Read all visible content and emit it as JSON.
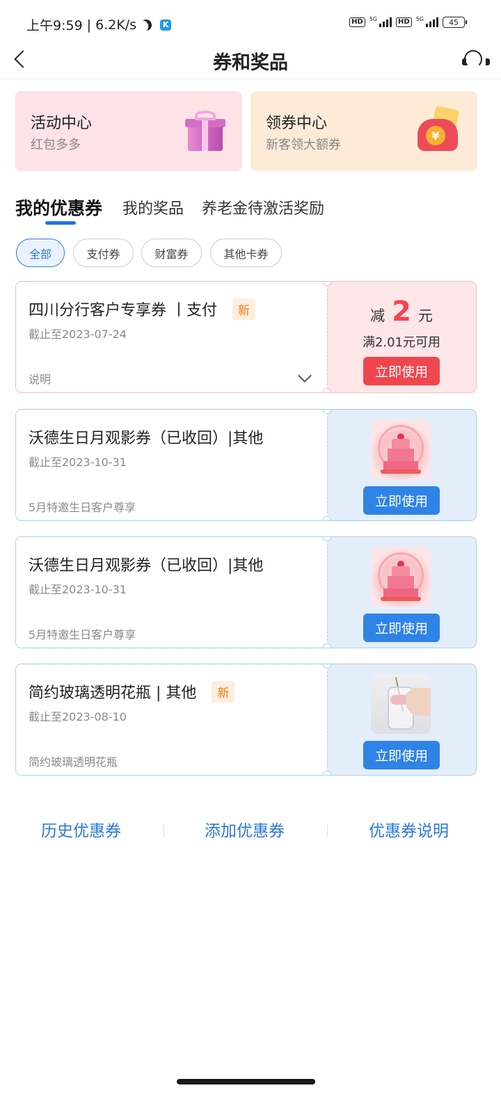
{
  "status_bar": {
    "time": "上午9:59",
    "speed": "| 6.2K/s",
    "hd1": "HD",
    "hd2": "HD",
    "net1": "5G",
    "net2": "5G",
    "battery": "45"
  },
  "header": {
    "title": "券和奖品",
    "back_icon": "back-arrow-icon",
    "service_icon": "headset-icon"
  },
  "promos": [
    {
      "title": "活动中心",
      "subtitle": "红包多多",
      "icon": "gift-box-icon"
    },
    {
      "title": "领券中心",
      "subtitle": "新客领大额券",
      "icon": "red-envelope-icon"
    }
  ],
  "tabs": [
    {
      "label": "我的优惠券",
      "active": true
    },
    {
      "label": "我的奖品",
      "active": false
    },
    {
      "label": "养老金待激活奖励",
      "active": false
    }
  ],
  "filters": [
    {
      "label": "全部",
      "active": true
    },
    {
      "label": "支付券",
      "active": false
    },
    {
      "label": "财富券",
      "active": false
    },
    {
      "label": "其他卡券",
      "active": false
    }
  ],
  "coupons": [
    {
      "title": "四川分行客户专享券 丨支付",
      "badge": "新",
      "expiry": "截止至2023-07-24",
      "description": "说明",
      "discount_prefix": "减",
      "discount_amount": "2",
      "discount_unit": "元",
      "condition": "满2.01元可用",
      "action": "立即使用"
    },
    {
      "title": "沃德生日月观影券（已收回）|其他",
      "expiry": "截止至2023-10-31",
      "description": "5月特邀生日客户尊享",
      "thumbnail": "birthday-cake-image",
      "action": "立即使用"
    },
    {
      "title": "沃德生日月观影券（已收回）|其他",
      "expiry": "截止至2023-10-31",
      "description": "5月特邀生日客户尊享",
      "thumbnail": "birthday-cake-image",
      "action": "立即使用"
    },
    {
      "title": "简约玻璃透明花瓶 | 其他",
      "badge": "新",
      "expiry": "截止至2023-08-10",
      "description": "简约玻璃透明花瓶",
      "thumbnail": "glass-vase-image",
      "action": "立即使用"
    }
  ],
  "footer_links": [
    "历史优惠券",
    "添加优惠券",
    "优惠券说明"
  ],
  "colors": {
    "accent": "#1f73e8",
    "use_button_red": "#f0474e",
    "use_button_blue": "#2f83e6",
    "new_badge": "#f27a1a"
  }
}
